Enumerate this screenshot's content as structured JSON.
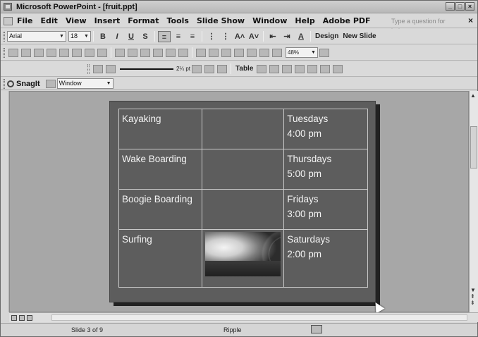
{
  "window": {
    "title": "Microsoft PowerPoint - [fruit.ppt]",
    "buttons": [
      "_",
      "□",
      "×"
    ]
  },
  "menubar": {
    "items": [
      "File",
      "Edit",
      "View",
      "Insert",
      "Format",
      "Tools",
      "Slide Show",
      "Window",
      "Help",
      "Adobe PDF"
    ],
    "ask_placeholder": "Type a question for help",
    "close": "×"
  },
  "formatting_toolbar": {
    "font": "Arial",
    "size": "18",
    "bold": "B",
    "italic": "I",
    "underline": "U",
    "shadow": "S",
    "grow_font": "A˄",
    "shrink_font": "A˅",
    "font_color": "A",
    "design_label": "Design",
    "new_slide_label": "New Slide"
  },
  "standard_toolbar": {
    "zoom": "48%"
  },
  "tables_toolbar": {
    "line_weight": "2¼ pt",
    "table_label": "Table"
  },
  "snagit_bar": {
    "label": "SnagIt",
    "target": "Window"
  },
  "slide": {
    "rows": [
      {
        "activity": "Kayaking",
        "day": "Tuesdays",
        "time": "4:00 pm",
        "has_image": false
      },
      {
        "activity": "Wake Boarding",
        "day": "Thursdays",
        "time": "5:00 pm",
        "has_image": false
      },
      {
        "activity": "Boogie Boarding",
        "day": "Fridays",
        "time": "3:00 pm",
        "has_image": false
      },
      {
        "activity": "Surfing",
        "day": "Saturdays",
        "time": "2:00 pm",
        "has_image": true
      }
    ]
  },
  "status": {
    "slide_indicator": "Slide 3 of 9",
    "design_name": "Ripple"
  }
}
